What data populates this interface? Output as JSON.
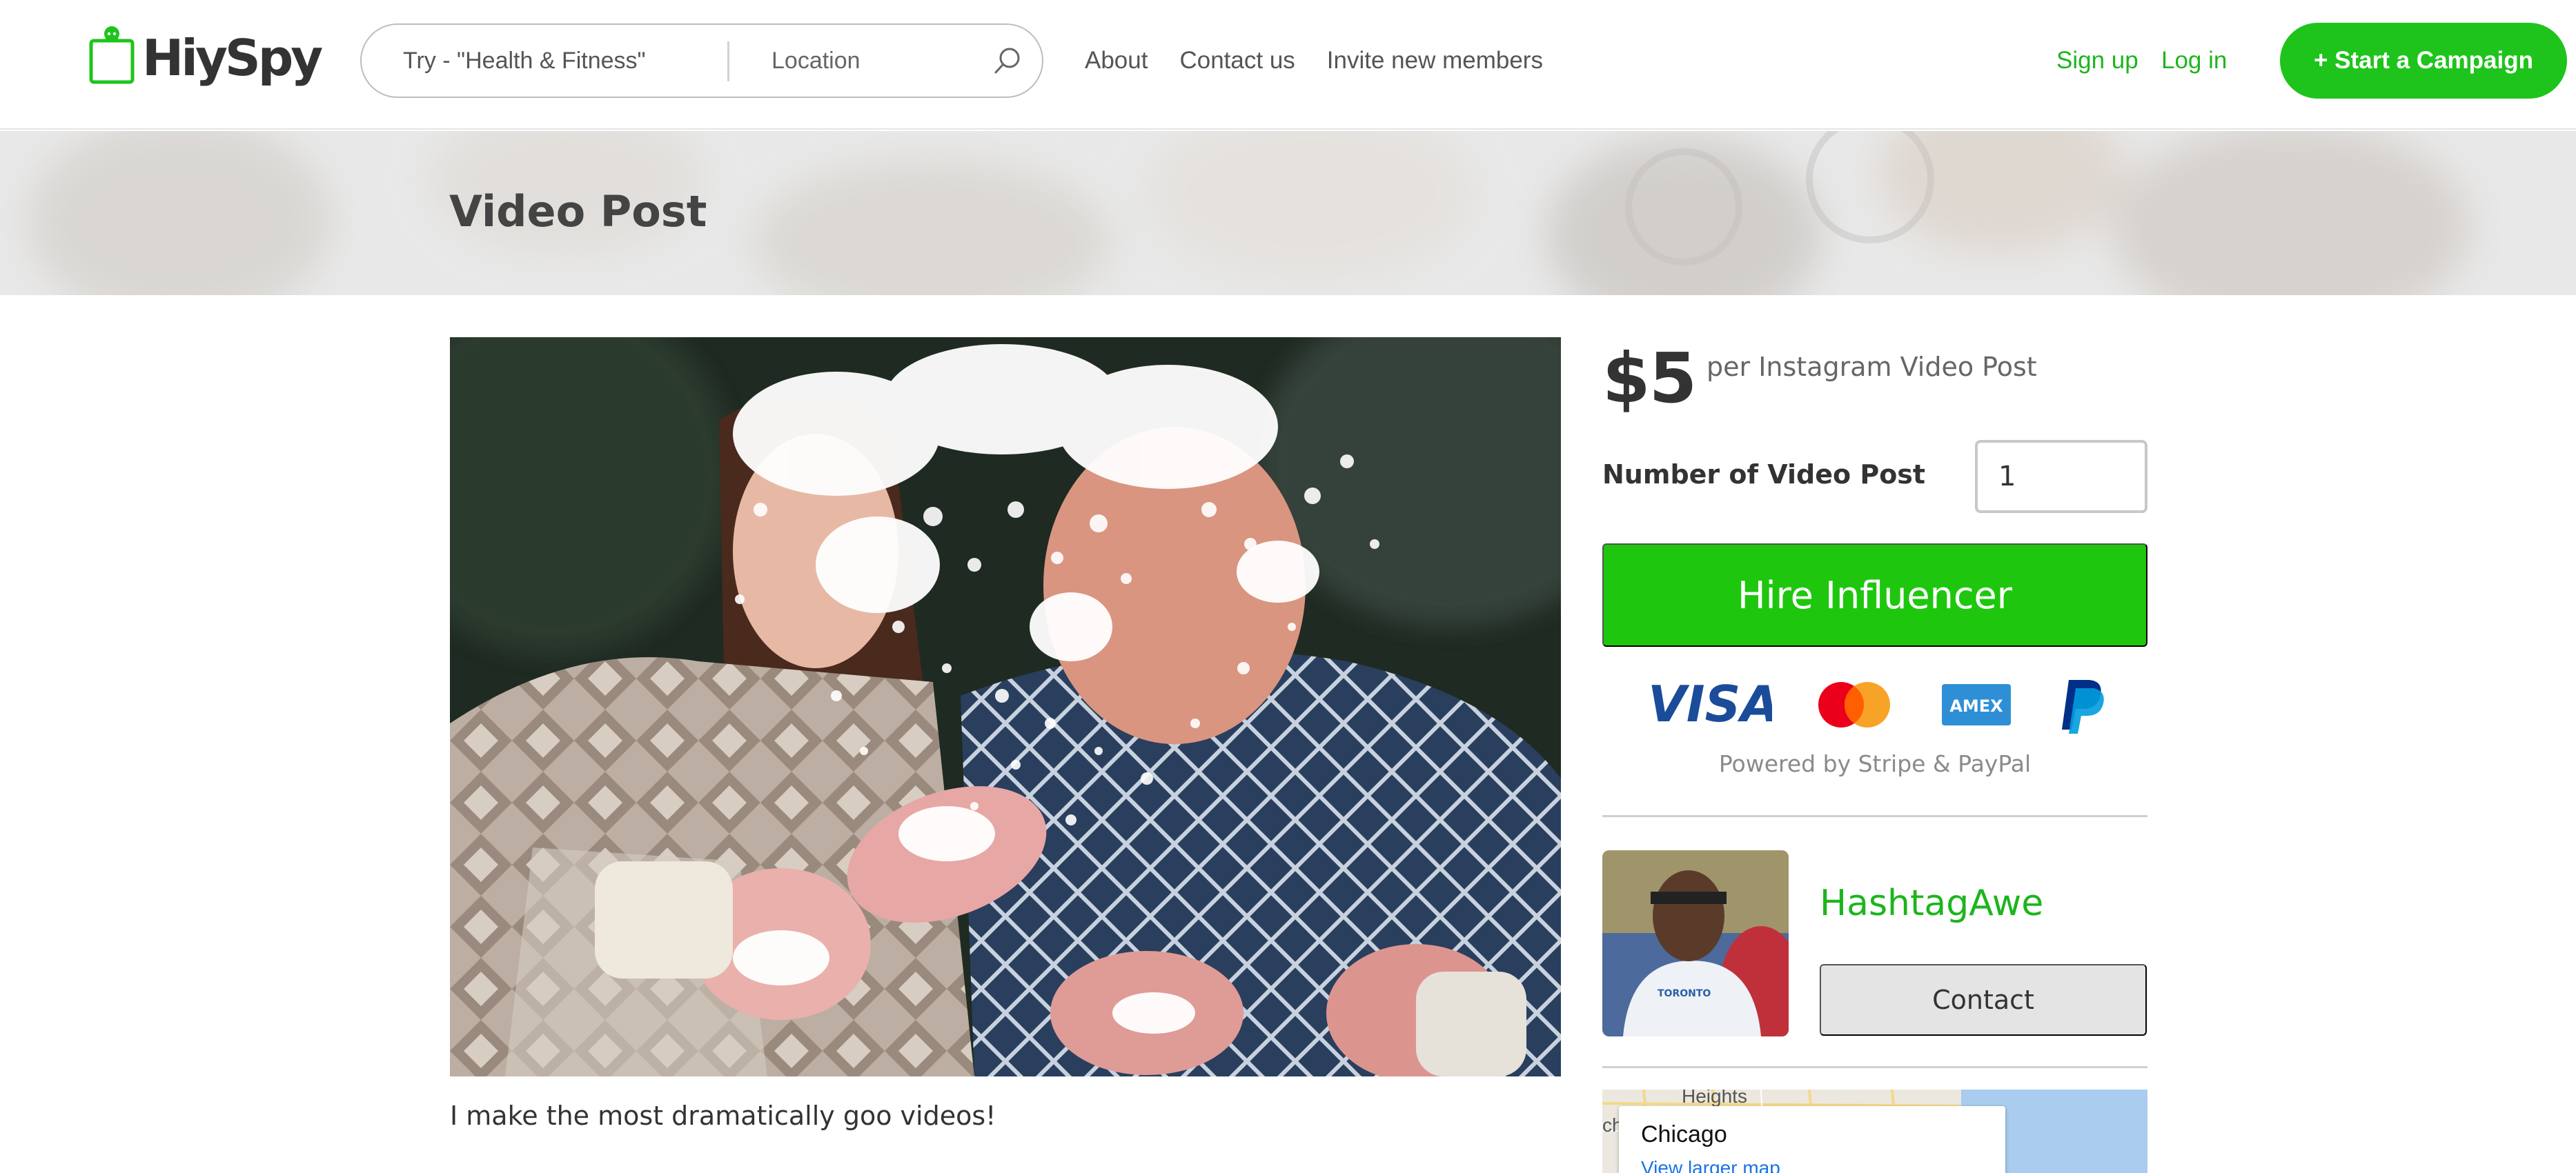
{
  "brand": {
    "name": "HiySpy",
    "accent": "#1ec41c",
    "link_color": "#1fb51f"
  },
  "search": {
    "topic_placeholder": "Try - \"Health & Fitness\"",
    "location_placeholder": "Location"
  },
  "nav": {
    "items": [
      {
        "label": "About"
      },
      {
        "label": "Contact us"
      },
      {
        "label": "Invite new members"
      }
    ]
  },
  "auth": {
    "signup": "Sign up",
    "login": "Log in"
  },
  "cta": {
    "label": "+ Start a Campaign"
  },
  "banner": {
    "title": "Video Post"
  },
  "post": {
    "caption": "I make the most dramatically goo videos!"
  },
  "offer": {
    "price": "$5",
    "unit": "per Instagram Video Post",
    "quantity_label": "Number of Video Post",
    "quantity_value": "1",
    "hire_label": "Hire Influencer",
    "payment_methods": [
      "visa-icon",
      "mastercard-icon",
      "amex-icon",
      "paypal-icon"
    ],
    "powered_by": "Powered by Stripe & PayPal"
  },
  "influencer": {
    "name": "HashtagAwe",
    "contact_label": "Contact"
  },
  "map": {
    "city": "Chicago",
    "link": "View larger map",
    "label_heights": "Heights",
    "label_partial": "ch"
  }
}
